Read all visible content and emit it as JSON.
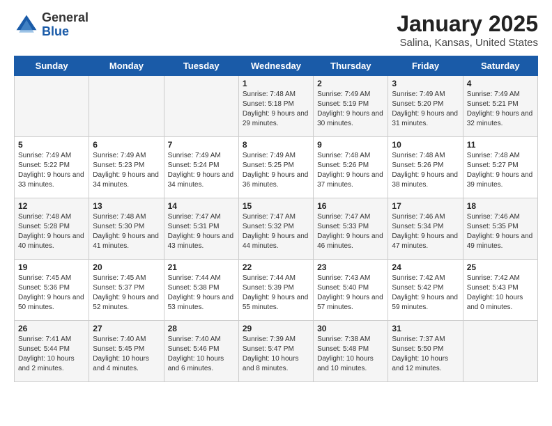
{
  "logo": {
    "general": "General",
    "blue": "Blue"
  },
  "header": {
    "title": "January 2025",
    "subtitle": "Salina, Kansas, United States"
  },
  "weekdays": [
    "Sunday",
    "Monday",
    "Tuesday",
    "Wednesday",
    "Thursday",
    "Friday",
    "Saturday"
  ],
  "weeks": [
    [
      {
        "day": "",
        "info": ""
      },
      {
        "day": "",
        "info": ""
      },
      {
        "day": "",
        "info": ""
      },
      {
        "day": "1",
        "info": "Sunrise: 7:48 AM\nSunset: 5:18 PM\nDaylight: 9 hours and 29 minutes."
      },
      {
        "day": "2",
        "info": "Sunrise: 7:49 AM\nSunset: 5:19 PM\nDaylight: 9 hours and 30 minutes."
      },
      {
        "day": "3",
        "info": "Sunrise: 7:49 AM\nSunset: 5:20 PM\nDaylight: 9 hours and 31 minutes."
      },
      {
        "day": "4",
        "info": "Sunrise: 7:49 AM\nSunset: 5:21 PM\nDaylight: 9 hours and 32 minutes."
      }
    ],
    [
      {
        "day": "5",
        "info": "Sunrise: 7:49 AM\nSunset: 5:22 PM\nDaylight: 9 hours and 33 minutes."
      },
      {
        "day": "6",
        "info": "Sunrise: 7:49 AM\nSunset: 5:23 PM\nDaylight: 9 hours and 34 minutes."
      },
      {
        "day": "7",
        "info": "Sunrise: 7:49 AM\nSunset: 5:24 PM\nDaylight: 9 hours and 34 minutes."
      },
      {
        "day": "8",
        "info": "Sunrise: 7:49 AM\nSunset: 5:25 PM\nDaylight: 9 hours and 36 minutes."
      },
      {
        "day": "9",
        "info": "Sunrise: 7:48 AM\nSunset: 5:26 PM\nDaylight: 9 hours and 37 minutes."
      },
      {
        "day": "10",
        "info": "Sunrise: 7:48 AM\nSunset: 5:26 PM\nDaylight: 9 hours and 38 minutes."
      },
      {
        "day": "11",
        "info": "Sunrise: 7:48 AM\nSunset: 5:27 PM\nDaylight: 9 hours and 39 minutes."
      }
    ],
    [
      {
        "day": "12",
        "info": "Sunrise: 7:48 AM\nSunset: 5:28 PM\nDaylight: 9 hours and 40 minutes."
      },
      {
        "day": "13",
        "info": "Sunrise: 7:48 AM\nSunset: 5:30 PM\nDaylight: 9 hours and 41 minutes."
      },
      {
        "day": "14",
        "info": "Sunrise: 7:47 AM\nSunset: 5:31 PM\nDaylight: 9 hours and 43 minutes."
      },
      {
        "day": "15",
        "info": "Sunrise: 7:47 AM\nSunset: 5:32 PM\nDaylight: 9 hours and 44 minutes."
      },
      {
        "day": "16",
        "info": "Sunrise: 7:47 AM\nSunset: 5:33 PM\nDaylight: 9 hours and 46 minutes."
      },
      {
        "day": "17",
        "info": "Sunrise: 7:46 AM\nSunset: 5:34 PM\nDaylight: 9 hours and 47 minutes."
      },
      {
        "day": "18",
        "info": "Sunrise: 7:46 AM\nSunset: 5:35 PM\nDaylight: 9 hours and 49 minutes."
      }
    ],
    [
      {
        "day": "19",
        "info": "Sunrise: 7:45 AM\nSunset: 5:36 PM\nDaylight: 9 hours and 50 minutes."
      },
      {
        "day": "20",
        "info": "Sunrise: 7:45 AM\nSunset: 5:37 PM\nDaylight: 9 hours and 52 minutes."
      },
      {
        "day": "21",
        "info": "Sunrise: 7:44 AM\nSunset: 5:38 PM\nDaylight: 9 hours and 53 minutes."
      },
      {
        "day": "22",
        "info": "Sunrise: 7:44 AM\nSunset: 5:39 PM\nDaylight: 9 hours and 55 minutes."
      },
      {
        "day": "23",
        "info": "Sunrise: 7:43 AM\nSunset: 5:40 PM\nDaylight: 9 hours and 57 minutes."
      },
      {
        "day": "24",
        "info": "Sunrise: 7:42 AM\nSunset: 5:42 PM\nDaylight: 9 hours and 59 minutes."
      },
      {
        "day": "25",
        "info": "Sunrise: 7:42 AM\nSunset: 5:43 PM\nDaylight: 10 hours and 0 minutes."
      }
    ],
    [
      {
        "day": "26",
        "info": "Sunrise: 7:41 AM\nSunset: 5:44 PM\nDaylight: 10 hours and 2 minutes."
      },
      {
        "day": "27",
        "info": "Sunrise: 7:40 AM\nSunset: 5:45 PM\nDaylight: 10 hours and 4 minutes."
      },
      {
        "day": "28",
        "info": "Sunrise: 7:40 AM\nSunset: 5:46 PM\nDaylight: 10 hours and 6 minutes."
      },
      {
        "day": "29",
        "info": "Sunrise: 7:39 AM\nSunset: 5:47 PM\nDaylight: 10 hours and 8 minutes."
      },
      {
        "day": "30",
        "info": "Sunrise: 7:38 AM\nSunset: 5:48 PM\nDaylight: 10 hours and 10 minutes."
      },
      {
        "day": "31",
        "info": "Sunrise: 7:37 AM\nSunset: 5:50 PM\nDaylight: 10 hours and 12 minutes."
      },
      {
        "day": "",
        "info": ""
      }
    ]
  ]
}
